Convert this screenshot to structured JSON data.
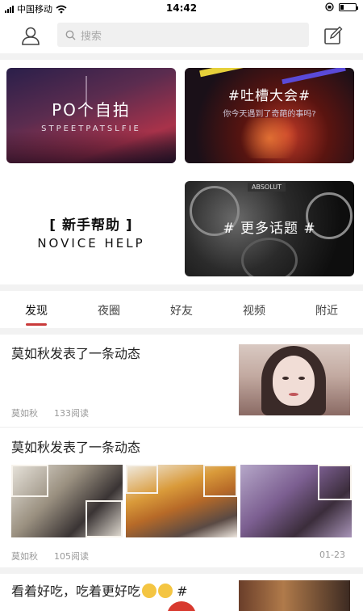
{
  "status_bar": {
    "carrier": "中国移动",
    "time": "14:42"
  },
  "header": {
    "search_placeholder": "搜索"
  },
  "banners": {
    "selfie": {
      "title": "PO个自拍",
      "subtitle": "STPEETPATSLFIE"
    },
    "rant": {
      "title": "#吐槽大会#",
      "subtitle": "你今天遇到了奇葩的事吗?"
    },
    "novice": {
      "title": "[ 新手帮助 ]",
      "subtitle": "NOVICE HELP"
    },
    "topics": {
      "title": "# 更多话题 #",
      "tag": "ABSOLUT"
    }
  },
  "tabs": [
    {
      "label": "发现",
      "active": true
    },
    {
      "label": "夜圈",
      "active": false
    },
    {
      "label": "好友",
      "active": false
    },
    {
      "label": "视频",
      "active": false
    },
    {
      "label": "附近",
      "active": false
    }
  ],
  "posts": [
    {
      "title": "莫如秋发表了一条动态",
      "author": "莫如秋",
      "reads": "133阅读"
    },
    {
      "title": "莫如秋发表了一条动态",
      "author": "莫如秋",
      "reads": "105阅读",
      "date": "01-23"
    },
    {
      "title": "看着好吃，吃着更好吃",
      "suffix": "#"
    }
  ],
  "colors": {
    "accent": "#d8392e",
    "tab_underline": "#c93a3a"
  }
}
